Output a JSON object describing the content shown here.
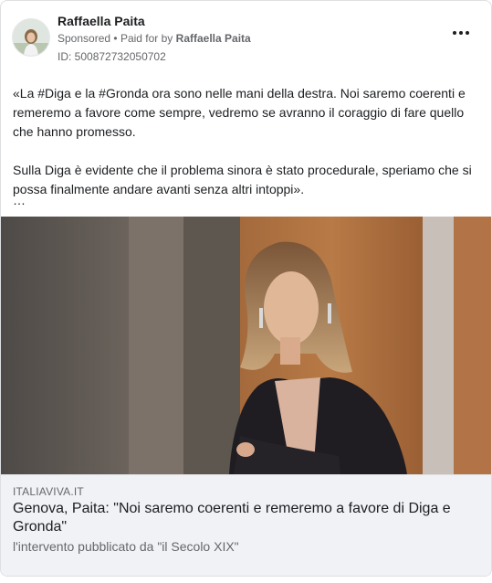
{
  "post": {
    "author": "Raffaella Paita",
    "sponsored_label": "Sponsored",
    "separator": "•",
    "paid_for_prefix": "Paid for by",
    "paid_for_name": "Raffaella Paita",
    "library_id": "ID: 500872732050702",
    "more_icon": "more-horizontal-icon",
    "text_paragraph_1": "«La #Diga e la #Gronda ora sono nelle mani della destra. Noi saremo coerenti e remeremo a favore come sempre, vedremo se avranno il coraggio di fare quello che hanno promesso.",
    "text_paragraph_2": "Sulla Diga è evidente che il problema sinora è stato procedurale, speriamo che si possa finalmente andare avanti senza altri intoppi».",
    "ellipsis": "…"
  },
  "link": {
    "domain": "ITALIAVIVA.IT",
    "title": "Genova, Paita: \"Noi saremo coerenti e remeremo a favore di Diga e Gronda\"",
    "description": "l'intervento pubblicato da \"il Secolo XIX\""
  },
  "colors": {
    "text": "#1c1e21",
    "secondary": "#65676b",
    "link_bg": "#f0f2f5",
    "border": "#dddfe2"
  }
}
